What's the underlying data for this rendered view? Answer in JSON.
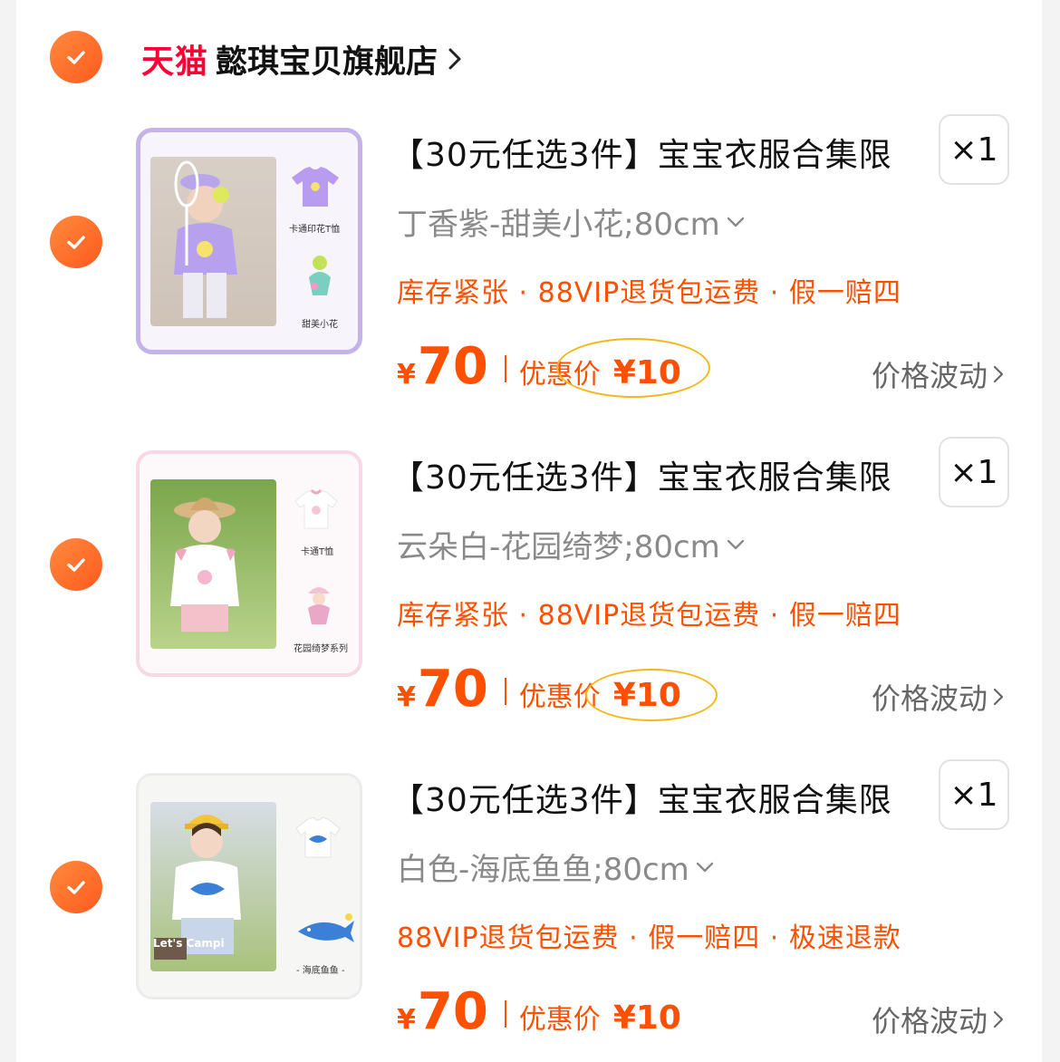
{
  "store": {
    "platform": "天猫",
    "name": "懿琪宝贝旗舰店"
  },
  "colors": {
    "accent": "#ff5000",
    "check": "#ff6a2a",
    "tmall": "#ff0036",
    "highlight_oval": "#f5b81c"
  },
  "items": [
    {
      "title": "【30元任选3件】宝宝衣服合集限",
      "qty": "×1",
      "variant": "丁香紫-甜美小花;80cm",
      "tags": "库存紧张 · 88VIP退货包运费 · 假一赔四",
      "currency": "¥",
      "price": "70",
      "discount_label": "优惠价",
      "discount_price": "¥10",
      "fluct_label": "价格波动",
      "thumb_labels": [
        "卡通印花T恤",
        "甜美小花"
      ],
      "checked": true
    },
    {
      "title": "【30元任选3件】宝宝衣服合集限",
      "qty": "×1",
      "variant": "云朵白-花园绮梦;80cm",
      "tags": "库存紧张 · 88VIP退货包运费 · 假一赔四",
      "currency": "¥",
      "price": "70",
      "discount_label": "优惠价",
      "discount_price": "¥10",
      "fluct_label": "价格波动",
      "thumb_labels": [
        "卡通T恤",
        "花园绮梦系列"
      ],
      "checked": true
    },
    {
      "title": "【30元任选3件】宝宝衣服合集限",
      "qty": "×1",
      "variant": "白色-海底鱼鱼;80cm",
      "tags": "88VIP退货包运费 · 假一赔四 · 极速退款",
      "currency": "¥",
      "price": "70",
      "discount_label": "优惠价",
      "discount_price": "¥10",
      "fluct_label": "价格波动",
      "thumb_labels": [
        "- 海底鱼鱼 -",
        "Let's Campi"
      ],
      "checked": true
    }
  ]
}
